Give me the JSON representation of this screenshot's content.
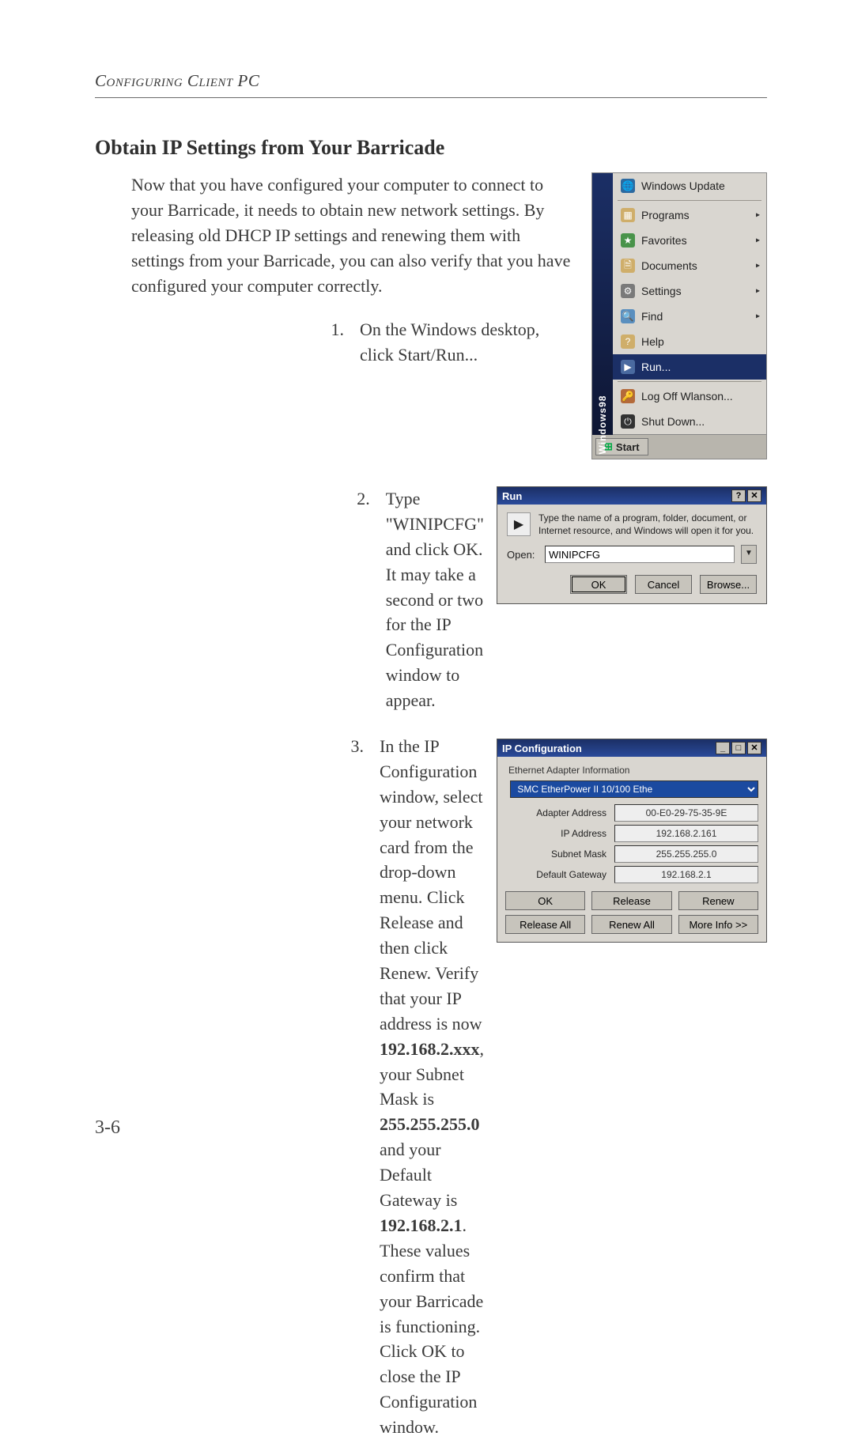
{
  "running_head": "Configuring Client PC",
  "heading": "Obtain IP Settings from Your Barricade",
  "intro": "Now that you have configured your computer to connect to your Barricade, it needs to obtain new network settings. By releasing old DHCP IP settings and renewing them with settings from your Barricade, you can also verify that you have configured your computer correctly.",
  "steps": {
    "s1_num": "1.",
    "s1": "On the Windows desktop, click Start/Run...",
    "s2_num": "2.",
    "s2": "Type \"WINIPCFG\" and click OK. It may take a second or two for the IP Configuration window to appear.",
    "s3_num": "3.",
    "s3a": "In the IP Configuration window, select your network card from the drop-down menu. Click Release and then click Renew. Verify that your IP address is now ",
    "s3_ip": "192.168.2.xxx",
    "s3b": ", your Subnet Mask is ",
    "s3_mask": "255.255.255.0",
    "s3c": " and your Default Gateway is ",
    "s3_gw": "192.168.2.1",
    "s3d": ". These values confirm that your Barricade is functioning. Click OK to close the IP Configuration window."
  },
  "page_number": "3-6",
  "start_menu": {
    "side_label": "Windows98",
    "items": [
      {
        "icon": "globe-icon",
        "label": "Windows Update",
        "sub": false
      },
      {
        "icon": "programs-icon",
        "label": "Programs",
        "sub": true,
        "ul": "P"
      },
      {
        "icon": "favorites-icon",
        "label": "Favorites",
        "sub": true,
        "ul": "F"
      },
      {
        "icon": "documents-icon",
        "label": "Documents",
        "sub": true,
        "ul": "D"
      },
      {
        "icon": "settings-icon",
        "label": "Settings",
        "sub": true,
        "ul": "S"
      },
      {
        "icon": "find-icon",
        "label": "Find",
        "sub": true,
        "ul": "F"
      },
      {
        "icon": "help-icon",
        "label": "Help",
        "sub": false,
        "ul": "H"
      },
      {
        "icon": "run-icon",
        "label": "Run...",
        "sub": false,
        "sel": true,
        "ul": "R"
      },
      {
        "icon": "logoff-icon",
        "label": "Log Off Wlanson...",
        "sub": false,
        "ul": "L"
      },
      {
        "icon": "shutdown-icon",
        "label": "Shut Down...",
        "sub": false,
        "ul": "u"
      }
    ],
    "start_label": "Start"
  },
  "run_dialog": {
    "title": "Run",
    "desc": "Type the name of a program, folder, document, or Internet resource, and Windows will open it for you.",
    "open_label": "Open:",
    "open_value": "WINIPCFG",
    "ok": "OK",
    "cancel": "Cancel",
    "browse": "Browse..."
  },
  "ipcfg": {
    "title": "IP Configuration",
    "group": "Ethernet Adapter Information",
    "adapter_selected": "SMC EtherPower II 10/100 Ethe",
    "rows": [
      {
        "label": "Adapter Address",
        "value": "00-E0-29-75-35-9E"
      },
      {
        "label": "IP Address",
        "value": "192.168.2.161"
      },
      {
        "label": "Subnet Mask",
        "value": "255.255.255.0"
      },
      {
        "label": "Default Gateway",
        "value": "192.168.2.1"
      }
    ],
    "btns": {
      "ok": "OK",
      "release": "Release",
      "renew": "Renew",
      "release_all": "Release All",
      "renew_all": "Renew All",
      "more": "More Info >>"
    }
  }
}
